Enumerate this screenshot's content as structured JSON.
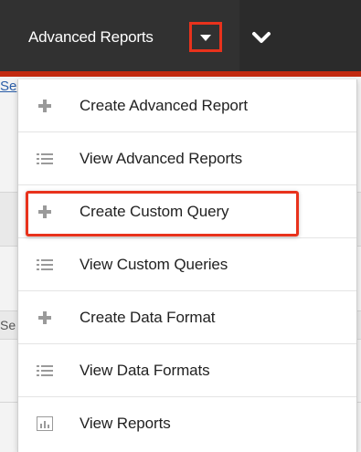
{
  "navbar": {
    "tab_label": "Advanced Reports",
    "accent_color": "#e8321c",
    "underline_color": "#c22a10",
    "caret_icon": "caret-down-icon",
    "more_icon": "chevron-down-icon"
  },
  "background": {
    "link_fragment": "Se",
    "row_stub": "Se"
  },
  "menu": {
    "items": [
      {
        "label": "Create Advanced Report",
        "icon": "plus-icon"
      },
      {
        "label": "View Advanced Reports",
        "icon": "list-icon"
      },
      {
        "label": "Create Custom Query",
        "icon": "plus-icon",
        "highlighted": true
      },
      {
        "label": "View Custom Queries",
        "icon": "list-icon"
      },
      {
        "label": "Create Data Format",
        "icon": "plus-icon"
      },
      {
        "label": "View Data Formats",
        "icon": "list-icon"
      },
      {
        "label": "View Reports",
        "icon": "bar-chart-icon"
      }
    ]
  }
}
